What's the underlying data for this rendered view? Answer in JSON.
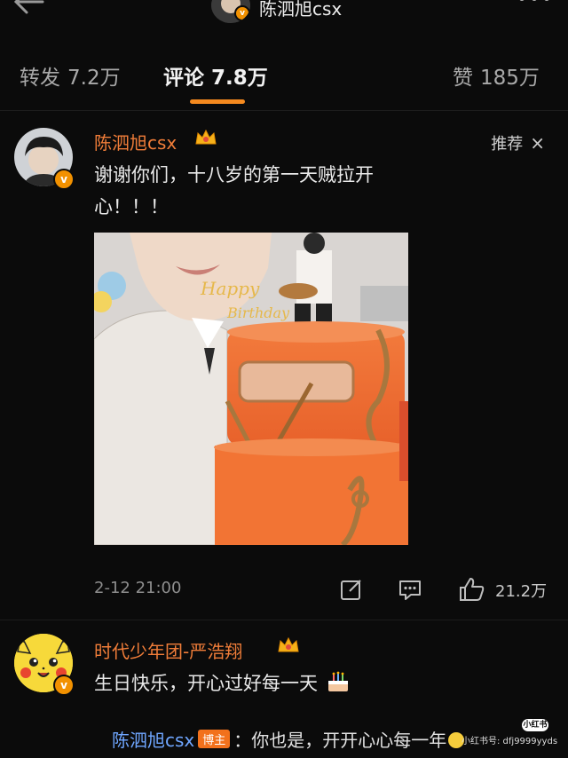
{
  "header": {
    "title": "陈泗旭csx",
    "icons": {
      "back": "back-arrow-icon",
      "more": "more-dots-icon",
      "verified": "verified-badge-icon"
    }
  },
  "tabs": [
    {
      "label": "转发",
      "count": "7.2万",
      "active": false
    },
    {
      "label": "评论",
      "count": "7.8万",
      "active": true
    },
    {
      "label": "赞",
      "count": "185万",
      "active": false
    }
  ],
  "colors": {
    "accent": "#f58a1f",
    "username": "#f07d39",
    "reply_name": "#6fa6ff",
    "background": "#0b0b0b"
  },
  "comments": [
    {
      "username": "陈泗旭csx",
      "badge_icon": "crown-icon",
      "recommend_label": "推荐",
      "close_glyph": "×",
      "text": "谢谢你们，十八岁的第一天贼拉开心！！！",
      "text_line1": "谢谢你们，十八岁的第一天贼拉开",
      "text_line2": "心！！！",
      "image": "birthday-cake-photo",
      "time": "2-12 21:00",
      "likes": "21.2万",
      "action_icons": [
        "edit-icon",
        "comment-icon",
        "like-icon"
      ]
    },
    {
      "username": "时代少年团-严浩翔",
      "badge_icon": "crown-icon",
      "text": "生日快乐，开心过好每一天",
      "emoji": "cake-emoji-icon",
      "reply": {
        "author": "陈泗旭csx",
        "author_tag": "博主",
        "text": "：你也是，开开心心每一年"
      }
    }
  ],
  "watermark": {
    "text": "小红书号: dfj9999yyds",
    "logo": "小红书"
  }
}
